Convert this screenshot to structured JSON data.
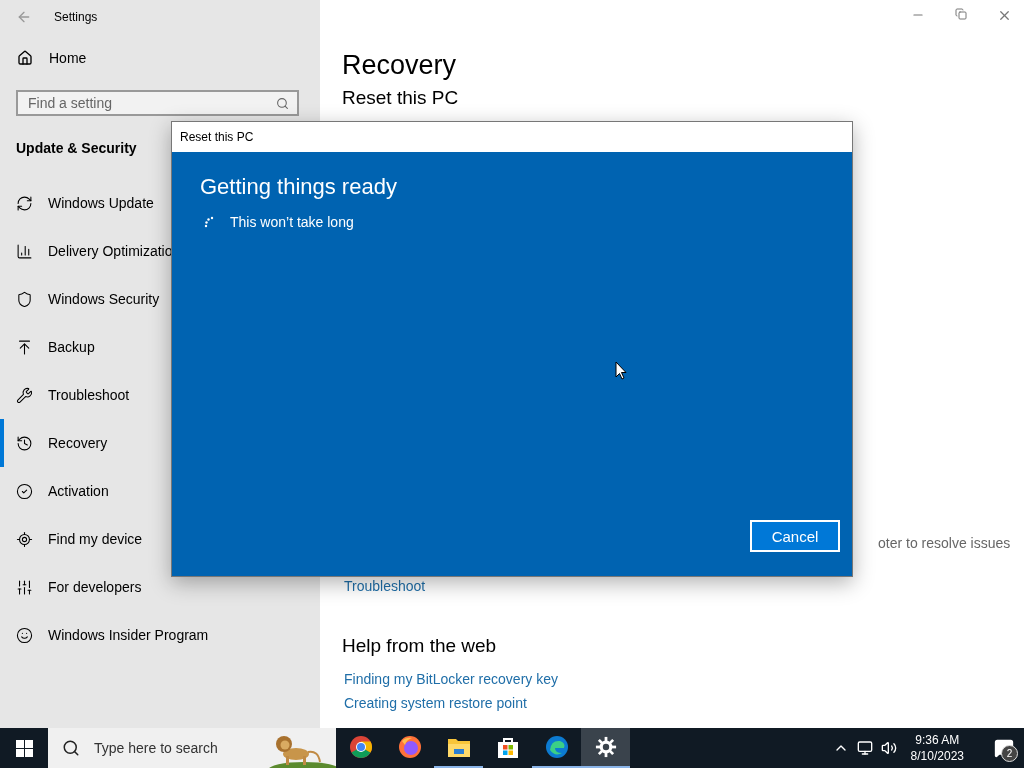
{
  "window": {
    "title": "Settings"
  },
  "sidebar": {
    "home": "Home",
    "search": {
      "placeholder": "Find a setting"
    },
    "section": "Update & Security",
    "items": [
      {
        "label": "Windows Update",
        "selected": false
      },
      {
        "label": "Delivery Optimizatio",
        "selected": false
      },
      {
        "label": "Windows Security",
        "selected": false
      },
      {
        "label": "Backup",
        "selected": false
      },
      {
        "label": "Troubleshoot",
        "selected": false
      },
      {
        "label": "Recovery",
        "selected": true
      },
      {
        "label": "Activation",
        "selected": false
      },
      {
        "label": "Find my device",
        "selected": false
      },
      {
        "label": "For developers",
        "selected": false
      },
      {
        "label": "Windows Insider Program",
        "selected": false
      }
    ]
  },
  "main": {
    "title": "Recovery",
    "section_heading": "Reset this PC",
    "side_text": "oter to resolve issues",
    "link": "Troubleshoot",
    "help_heading": "Help from the web",
    "help_links": [
      "Finding my BitLocker recovery key",
      "Creating system restore point"
    ]
  },
  "dialog": {
    "title": "Reset this PC",
    "heading": "Getting things ready",
    "status": "This won’t take long",
    "button": "Cancel"
  },
  "taskbar": {
    "search_placeholder": "Type here to search",
    "apps": [
      {
        "running": false,
        "selected": false
      },
      {
        "running": false,
        "selected": false
      },
      {
        "running": true,
        "selected": false
      },
      {
        "running": false,
        "selected": false
      },
      {
        "running": true,
        "selected": false
      },
      {
        "running": true,
        "selected": true
      }
    ],
    "time": "9:36 AM",
    "date": "8/10/2023",
    "notifications": "2"
  }
}
